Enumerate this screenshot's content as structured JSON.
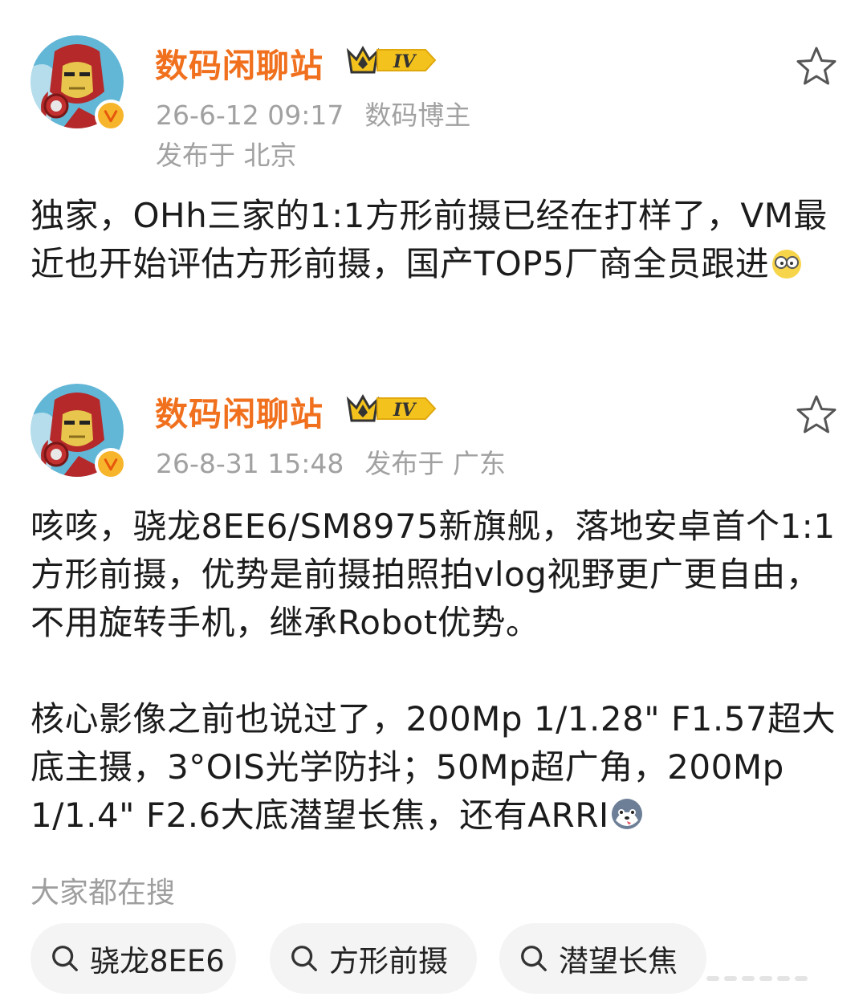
{
  "posts": [
    {
      "username": "数码闲聊站",
      "level": "IV",
      "time": "26-6-12 09:17",
      "tag": "数码博主",
      "location": "发布于 北京",
      "text": "独家，OHh三家的1:1方形前摄已经在打样了，VM最近也开始评估方形前摄，国产TOP5厂商全员跟进",
      "avatar_icon": "iron-man-avatar",
      "emoji": "glasses-face-emoji"
    },
    {
      "username": "数码闲聊站",
      "level": "IV",
      "time": "26-8-31 15:48",
      "location": "发布于 广东",
      "paragraph1": "咳咳，骁龙8EE6/SM8975新旗舰，落地安卓首个1:1方形前摄，优势是前摄拍照拍vlog视野更广更自由，不用旋转手机，继承Robot优势。",
      "paragraph2": "核心影像之前也说过了，200Mp 1/1.28\" F1.57超大底主摄，3°OIS光学防抖；50Mp超广角，200Mp 1/1.4\" F2.6大底潜望长焦，还有ARRI",
      "avatar_icon": "iron-man-avatar",
      "emoji": "husky-emoji"
    }
  ],
  "search_section": {
    "label": "大家都在搜",
    "chips": [
      "骁龙8EE6",
      "方形前摄",
      "潜望长焦"
    ]
  },
  "colors": {
    "username": "#f0701e",
    "meta": "#a1a1a1",
    "chip_bg": "#f4f4f4",
    "verified": "#f7b52c"
  }
}
